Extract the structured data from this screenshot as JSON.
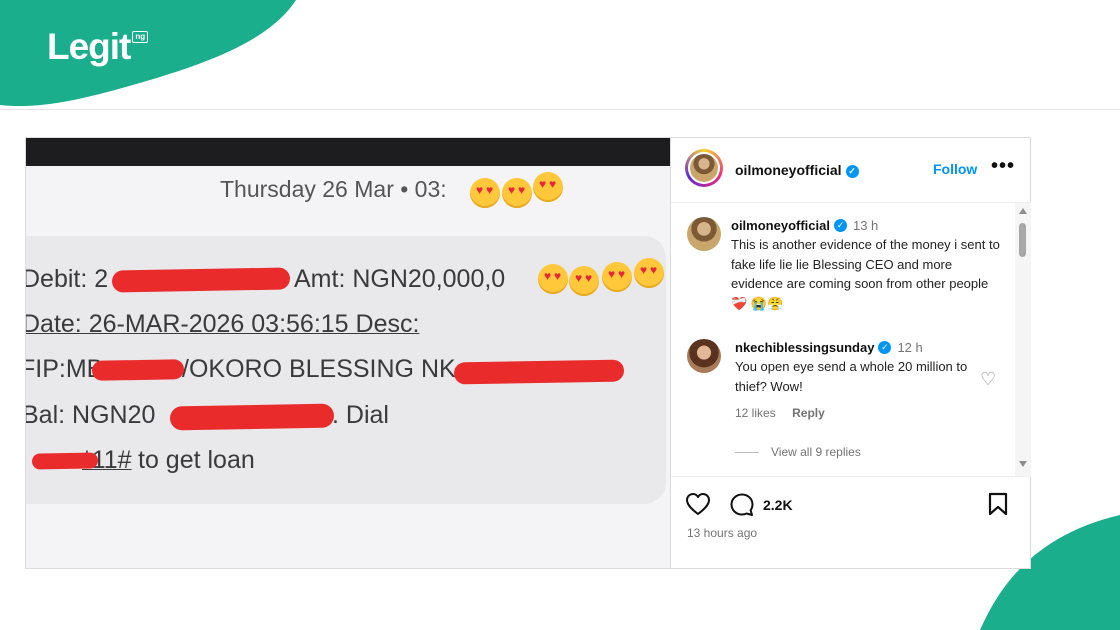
{
  "brand": {
    "logo_text": "Legit",
    "logo_suffix": "ng",
    "accent_color": "#1aae8d"
  },
  "post": {
    "photo": {
      "date_line": "Thursday 26 Mar • 03:",
      "sms_lines": [
        "Debit: 2",
        "Amt: NGN20,000,0",
        "Date: 26-MAR-2026 03:56:15 Desc:",
        "FIP:MB",
        "/OKORO BLESSING NK",
        "Bal: NGN20",
        ". Dial",
        "*11#",
        " to get loan"
      ]
    },
    "header": {
      "username": "oilmoneyofficial",
      "verified_icon": "verified-badge-icon",
      "follow_label": "Follow",
      "more_label": "•••"
    },
    "comments": [
      {
        "username": "oilmoneyofficial",
        "time": "13 h",
        "text": "This is another evidence of the money i sent to fake life lie lie Blessing CEO and more evidence are coming soon from other people ❤️‍🩹 😭😤"
      },
      {
        "username": "nkechiblessingsunday",
        "time": "12 h",
        "text": "You open eye send a whole 20 million to thief? Wow!",
        "likes": "12 likes",
        "reply_label": "Reply",
        "view_replies": "View all 9 replies"
      }
    ],
    "actions": {
      "comment_count": "2.2K",
      "time_ago": "13 hours ago"
    }
  }
}
